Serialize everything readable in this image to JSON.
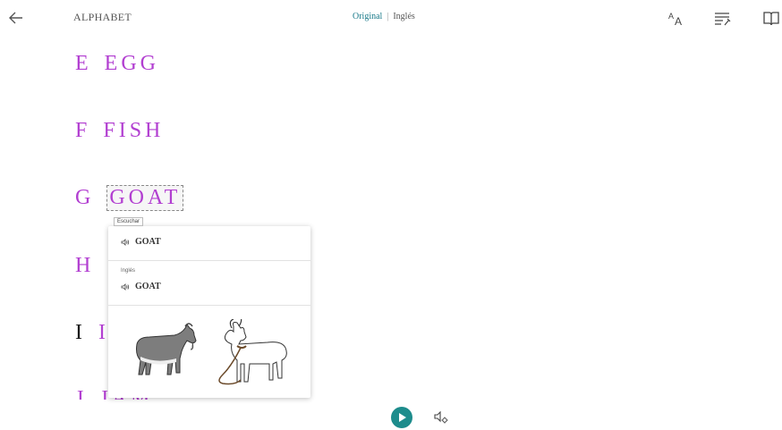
{
  "header": {
    "title": "ALPHABET",
    "lang_original": "Original",
    "lang_separator": "|",
    "lang_translation": "Inglés"
  },
  "icons": {
    "back": "back-arrow-icon",
    "text_size": "text-size-icon",
    "text_prefs": "text-preferences-icon",
    "reading_mode": "book-icon",
    "play": "play-icon",
    "voice": "voice-settings-icon"
  },
  "colors": {
    "letters": "#b23fd1",
    "accent": "#1d8c8c"
  },
  "lines": [
    {
      "letter": "E",
      "word": "EGG"
    },
    {
      "letter": "F",
      "word": "FISH"
    },
    {
      "letter": "G",
      "word": "GOAT"
    },
    {
      "letter": "H",
      "word": ""
    },
    {
      "letter": "I",
      "word": "I"
    },
    {
      "letter": "J",
      "word": "JAM"
    }
  ],
  "tooltip": "Escuchar",
  "popup": {
    "word": "GOAT",
    "lang_label": "Inglés",
    "translation": "GOAT",
    "images": [
      "grey-goat-image",
      "white-goat-image"
    ]
  }
}
